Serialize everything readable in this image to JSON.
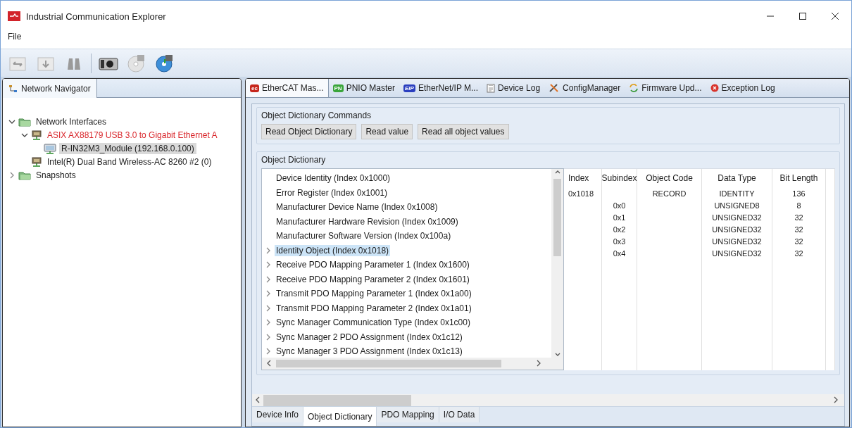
{
  "window": {
    "title": "Industrial Communication Explorer"
  },
  "menu": [
    "File"
  ],
  "navigator": {
    "tab": "Network Navigator",
    "tree": [
      {
        "label": "Network Interfaces",
        "kind": "folder",
        "expanded": true,
        "selected": false,
        "error": false,
        "children": [
          {
            "label": "ASIX AX88179 USB 3.0 to Gigabit Ethernet A",
            "kind": "adapter",
            "expanded": true,
            "selected": false,
            "error": true,
            "children": [
              {
                "label": "R-IN32M3_Module (192.168.0.100)",
                "kind": "device",
                "selected": true,
                "error": false
              }
            ]
          },
          {
            "label": "Intel(R) Dual Band Wireless-AC 8260 #2 (0)",
            "kind": "adapter",
            "selected": false,
            "error": false
          }
        ]
      },
      {
        "label": "Snapshots",
        "kind": "folder",
        "expanded": false,
        "selected": false,
        "error": false
      }
    ]
  },
  "tabs": [
    {
      "label": "EtherCAT Mas...",
      "badge": "ec",
      "selected": true
    },
    {
      "label": "PNIO Master",
      "badge": "PN",
      "selected": false
    },
    {
      "label": "EtherNet/IP M...",
      "badge": "EIP",
      "selected": false
    },
    {
      "label": "Device Log",
      "selected": false
    },
    {
      "label": "ConfigManager",
      "selected": false
    },
    {
      "label": "Firmware Upd...",
      "selected": false
    },
    {
      "label": "Exception Log",
      "selected": false
    }
  ],
  "commands": {
    "title": "Object Dictionary Commands",
    "buttons": [
      "Read Object Dictionary",
      "Read value",
      "Read all object values"
    ]
  },
  "dictionary": {
    "title": "Object Dictionary",
    "objects": [
      {
        "label": "Device Identity (Index 0x1000)",
        "expandable": false,
        "selected": false
      },
      {
        "label": "Error Register (Index 0x1001)",
        "expandable": false,
        "selected": false
      },
      {
        "label": "Manufacturer Device Name (Index 0x1008)",
        "expandable": false,
        "selected": false
      },
      {
        "label": "Manufacturer Hardware Revision (Index 0x1009)",
        "expandable": false,
        "selected": false
      },
      {
        "label": "Manufacturer Software Version (Index 0x100a)",
        "expandable": false,
        "selected": false
      },
      {
        "label": "Identity Object (Index 0x1018)",
        "expandable": true,
        "selected": true
      },
      {
        "label": "Receive PDO Mapping Parameter 1 (Index 0x1600)",
        "expandable": true,
        "selected": false
      },
      {
        "label": "Receive PDO Mapping Parameter 2 (Index 0x1601)",
        "expandable": true,
        "selected": false
      },
      {
        "label": "Transmit PDO Mapping Parameter 1 (Index 0x1a00)",
        "expandable": true,
        "selected": false
      },
      {
        "label": "Transmit PDO Mapping Parameter 2 (Index 0x1a01)",
        "expandable": true,
        "selected": false
      },
      {
        "label": "Sync Manager Communication Type (Index 0x1c00)",
        "expandable": true,
        "selected": false
      },
      {
        "label": "Sync Manager 2 PDO Assignment (Index 0x1c12)",
        "expandable": true,
        "selected": false
      },
      {
        "label": "Sync Manager 3 PDO Assignment (Index 0x1c13)",
        "expandable": true,
        "selected": false
      }
    ],
    "columns": [
      "Index",
      "Subindex",
      "Object Code",
      "Data Type",
      "Bit Length"
    ],
    "rows": [
      [
        "0x1018",
        "",
        "RECORD",
        "IDENTITY",
        "136"
      ],
      [
        "",
        "0x0",
        "",
        "UNSIGNED8",
        "8"
      ],
      [
        "",
        "0x1",
        "",
        "UNSIGNED32",
        "32"
      ],
      [
        "",
        "0x2",
        "",
        "UNSIGNED32",
        "32"
      ],
      [
        "",
        "0x3",
        "",
        "UNSIGNED32",
        "32"
      ],
      [
        "",
        "0x4",
        "",
        "UNSIGNED32",
        "32"
      ]
    ]
  },
  "bottom_tabs": [
    {
      "label": "Device Info",
      "selected": false
    },
    {
      "label": "Object Dictionary",
      "selected": true
    },
    {
      "label": "PDO Mapping",
      "selected": false
    },
    {
      "label": "I/O Data",
      "selected": false
    }
  ]
}
